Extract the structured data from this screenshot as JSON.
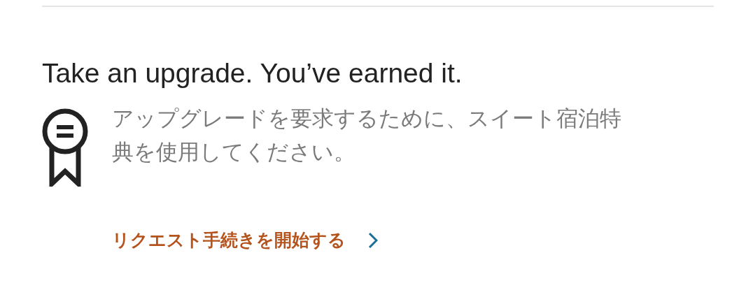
{
  "heading": "Take an upgrade. You’ve earned it.",
  "description": "アップグレードを要求するために、スイート宿泊特典を使用してください。",
  "link": {
    "label": "リクエスト手続きを開始する"
  }
}
